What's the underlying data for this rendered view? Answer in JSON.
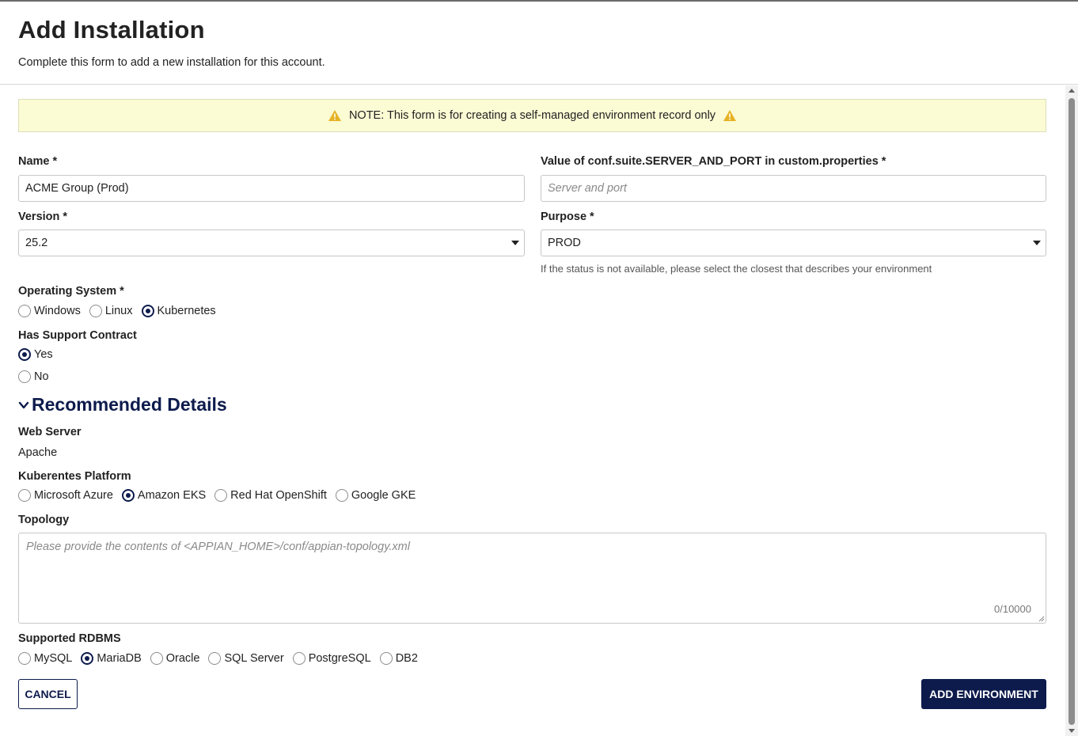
{
  "header": {
    "title": "Add Installation",
    "subtitle": "Complete this form to add a new installation for this account."
  },
  "note": {
    "text": "NOTE: This form is for creating a self-managed environment record only",
    "icon": "warning-icon",
    "icon_color": "#e6b325"
  },
  "required_marker": "*",
  "fields": {
    "name": {
      "label": "Name",
      "value": "ACME Group (Prod)"
    },
    "server_port": {
      "label": "Value of conf.suite.SERVER_AND_PORT in custom.properties",
      "placeholder": "Server and port"
    },
    "version": {
      "label": "Version",
      "value": "25.2"
    },
    "purpose": {
      "label": "Purpose",
      "value": "PROD",
      "help": "If the status is not available, please select the closest that describes your environment"
    },
    "os": {
      "label": "Operating System",
      "options": [
        "Windows",
        "Linux",
        "Kubernetes"
      ],
      "selected": "Kubernetes"
    },
    "support": {
      "label": "Has Support Contract",
      "options": [
        "Yes",
        "No"
      ],
      "selected": "Yes"
    }
  },
  "recommended": {
    "title": "Recommended Details",
    "web_server": {
      "label": "Web Server",
      "value": "Apache"
    },
    "k8s_platform": {
      "label": "Kuberentes Platform",
      "options": [
        "Microsoft Azure",
        "Amazon EKS",
        "Red Hat OpenShift",
        "Google GKE"
      ],
      "selected": "Amazon EKS"
    },
    "topology": {
      "label": "Topology",
      "placeholder": "Please provide the contents of <APPIAN_HOME>/conf/appian-topology.xml",
      "count": "0/10000"
    },
    "rdbms": {
      "label": "Supported RDBMS",
      "options": [
        "MySQL",
        "MariaDB",
        "Oracle",
        "SQL Server",
        "PostgreSQL",
        "DB2"
      ],
      "selected": "MariaDB"
    }
  },
  "buttons": {
    "cancel": "CANCEL",
    "add": "ADD ENVIRONMENT"
  },
  "colors": {
    "accent": "#0d1b4c",
    "note_bg": "#fbfbd4"
  }
}
